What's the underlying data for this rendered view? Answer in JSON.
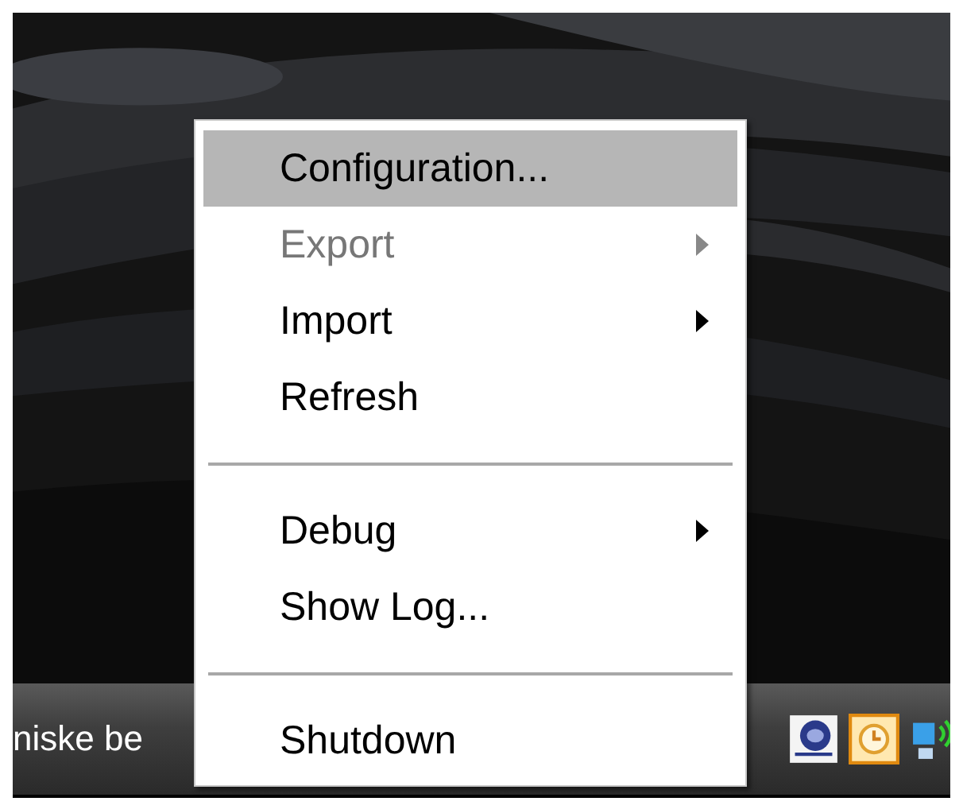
{
  "menu": {
    "items": [
      {
        "kind": "item",
        "label": "Configuration...",
        "selected": true,
        "disabled": false,
        "submenu": false
      },
      {
        "kind": "item",
        "label": "Export",
        "selected": false,
        "disabled": true,
        "submenu": true
      },
      {
        "kind": "item",
        "label": "Import",
        "selected": false,
        "disabled": false,
        "submenu": true
      },
      {
        "kind": "item",
        "label": "Refresh",
        "selected": false,
        "disabled": false,
        "submenu": false
      },
      {
        "kind": "separator"
      },
      {
        "kind": "item",
        "label": "Debug",
        "selected": false,
        "disabled": false,
        "submenu": true
      },
      {
        "kind": "item",
        "label": "Show Log...",
        "selected": false,
        "disabled": false,
        "submenu": false
      },
      {
        "kind": "separator"
      },
      {
        "kind": "item",
        "label": "Shutdown",
        "selected": false,
        "disabled": false,
        "submenu": false
      }
    ]
  },
  "taskbar": {
    "text": "niske be"
  }
}
